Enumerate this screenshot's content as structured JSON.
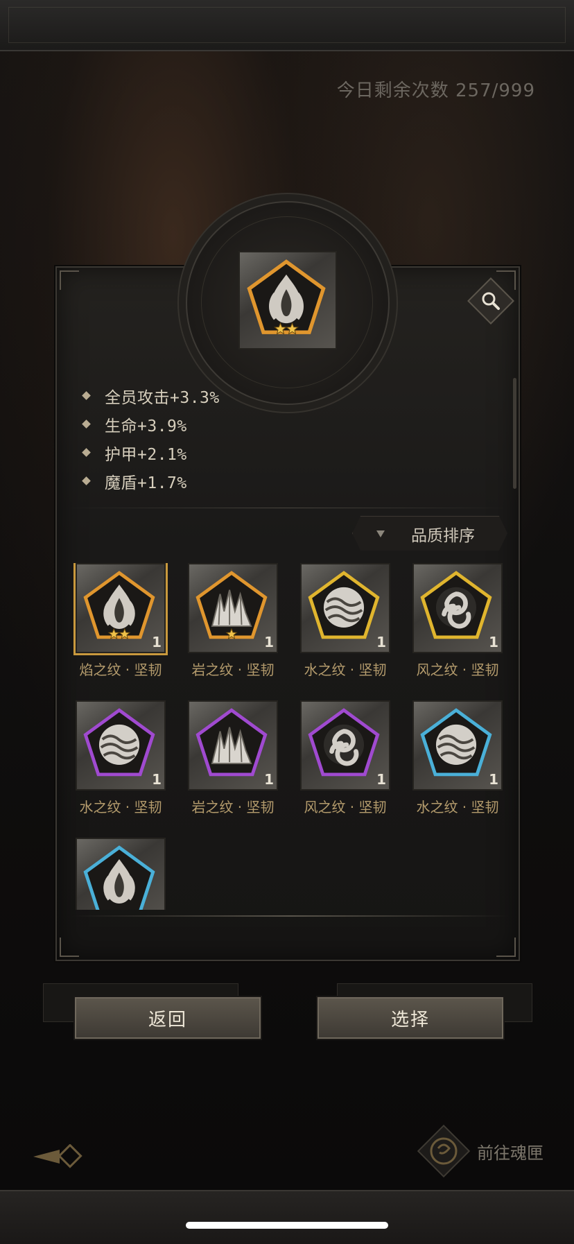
{
  "header": {
    "remaining_label": "今日剩余次数 257/999"
  },
  "selected_rune": {
    "stars": 2,
    "quality_color": "#e0962e"
  },
  "stats": [
    {
      "text": "全员攻击+3.3%"
    },
    {
      "text": "生命+3.9%"
    },
    {
      "text": "护甲+2.1%"
    },
    {
      "text": "魔盾+1.7%"
    }
  ],
  "sort": {
    "label": "品质排序"
  },
  "runes": [
    {
      "name": "焰之纹 · 坚韧",
      "count": "1",
      "element": "flame",
      "quality_color": "#e0962e",
      "stars": 2,
      "selected": true
    },
    {
      "name": "岩之纹 · 坚韧",
      "count": "1",
      "element": "rock",
      "quality_color": "#e0962e",
      "stars": 1,
      "selected": false
    },
    {
      "name": "水之纹 · 坚韧",
      "count": "1",
      "element": "water",
      "quality_color": "#e0b52e",
      "stars": 0,
      "selected": false
    },
    {
      "name": "风之纹 · 坚韧",
      "count": "1",
      "element": "wind",
      "quality_color": "#e0b52e",
      "stars": 0,
      "selected": false
    },
    {
      "name": "水之纹 · 坚韧",
      "count": "1",
      "element": "water",
      "quality_color": "#a04ad0",
      "stars": 0,
      "selected": false
    },
    {
      "name": "岩之纹 · 坚韧",
      "count": "1",
      "element": "rock",
      "quality_color": "#a04ad0",
      "stars": 0,
      "selected": false
    },
    {
      "name": "风之纹 · 坚韧",
      "count": "1",
      "element": "wind",
      "quality_color": "#a04ad0",
      "stars": 0,
      "selected": false
    },
    {
      "name": "水之纹 · 坚韧",
      "count": "1",
      "element": "water",
      "quality_color": "#4ab0d8",
      "stars": 0,
      "selected": false
    },
    {
      "name": "",
      "count": "",
      "element": "flame",
      "quality_color": "#4ab0d8",
      "stars": 0,
      "selected": false
    }
  ],
  "buttons": {
    "back": "返回",
    "select": "选择"
  },
  "nav": {
    "goto_label": "前往魂匣"
  }
}
